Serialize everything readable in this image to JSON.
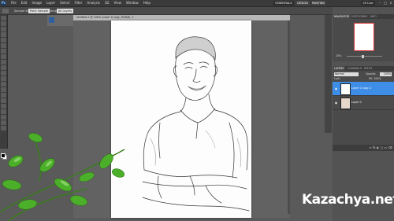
{
  "app": {
    "logo": "Ps"
  },
  "menu": [
    "File",
    "Edit",
    "Image",
    "Layer",
    "Select",
    "Filter",
    "Analysis",
    "3D",
    "View",
    "Window",
    "Help"
  ],
  "workspace": {
    "essentials": "ESSENTIALS",
    "design": "DESIGN",
    "painting": "PAINTING",
    "cs_live": "CS Live"
  },
  "window_controls": {
    "minimize": "–",
    "maximize": "□",
    "close": "×"
  },
  "options_bar": {
    "sample_label": "Sample Size:",
    "sample_value": "Point Sample",
    "sample_label2": "Sample:",
    "sample_value2": "All Layers",
    "ring": "Show Sampling Ring"
  },
  "left_panel": {
    "label": ""
  },
  "document": {
    "tab_title": "Untitled-1 @ 100% (Layer 0 copy, RGB/8)",
    "close": "×",
    "status": "100%   Doc: 1.48M/2.96M"
  },
  "navigator": {
    "tab_active": "NAVIGATOR",
    "tab_inactive": "HISTOGRAM",
    "tab_inactive2": "INFO",
    "zoom": "25%"
  },
  "layers": {
    "tab_active": "LAYERS",
    "tab_inactive": "CHANNELS",
    "tab_inactive2": "PATHS",
    "blend_mode": "Normal",
    "opacity_label": "Opacity:",
    "opacity_value": "100%",
    "lock_label": "Lock:",
    "fill_label": "Fill: 100%",
    "rows": [
      {
        "name": "Layer 0 copy 2",
        "selected": true
      },
      {
        "name": "Layer 0",
        "selected": false
      }
    ],
    "footer_icons": "∞ fx ◐ ◻ ▭ ⌫"
  },
  "watermark": {
    "text": "Kazachya.net"
  }
}
